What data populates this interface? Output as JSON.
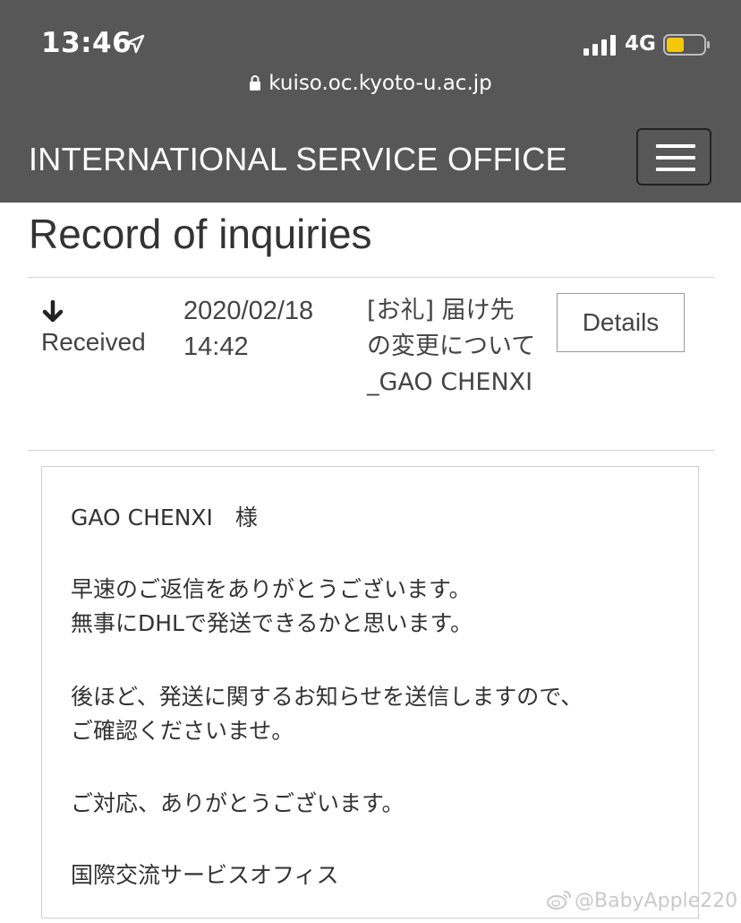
{
  "status_bar": {
    "time": "13:46",
    "network": "4G",
    "battery_color": "#f4c70b"
  },
  "url_bar": {
    "url": "kuiso.oc.kyoto-u.ac.jp"
  },
  "header": {
    "site_title": "INTERNATIONAL SERVICE OFFICE",
    "menu_icon": "hamburger-menu-icon",
    "background": "#575757"
  },
  "page": {
    "title": "Record of inquiries"
  },
  "inquiry": {
    "status_icon": "arrow-down-icon",
    "status": "Received",
    "date": "2020/02/18",
    "time": "14:42",
    "subject": "[お礼] 届け先の変更について_GAO CHENXI",
    "details_label": "Details"
  },
  "message": {
    "lines": [
      "GAO CHENXI　様",
      "早速のご返信をありがとうございます。",
      "無事にDHLで発送できるかと思います。",
      "後ほど、発送に関するお知らせを送信しますので、",
      "ご確認くださいませ。",
      "ご対応、ありがとうございます。",
      "国際交流サービスオフィス"
    ]
  },
  "watermark": {
    "text": "@BabyApple220",
    "icon": "weibo-icon"
  }
}
